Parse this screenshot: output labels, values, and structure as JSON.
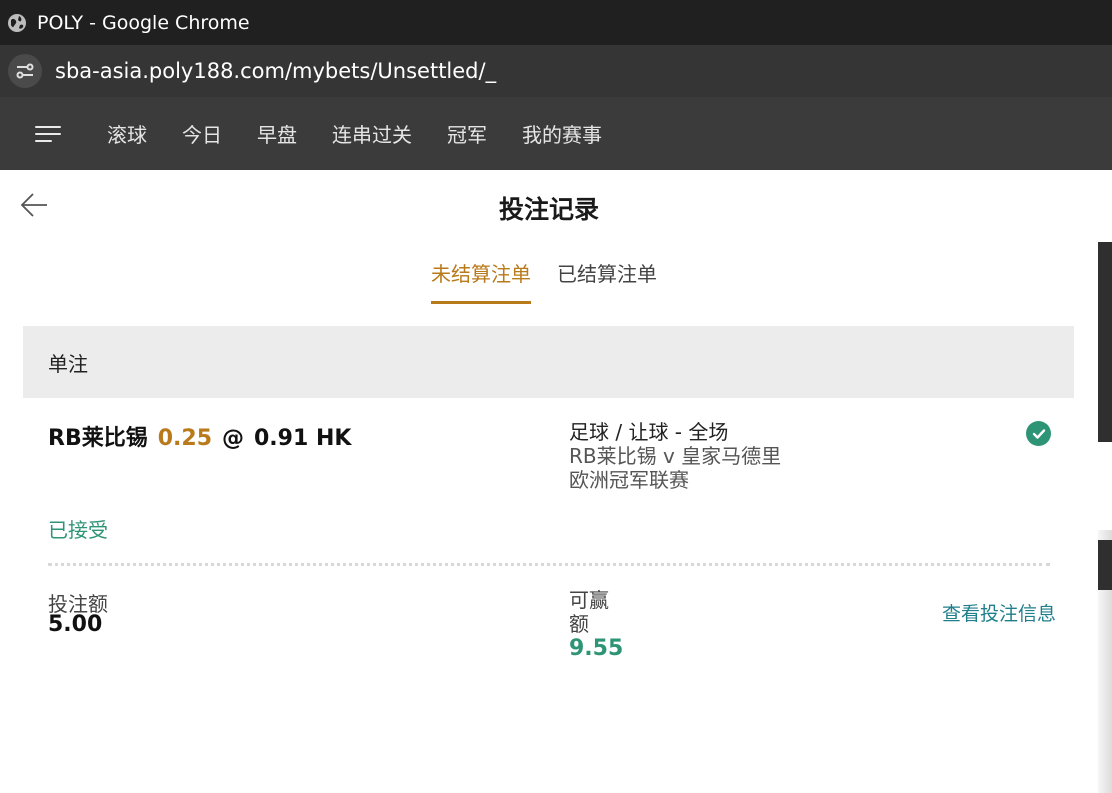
{
  "browser": {
    "window_title": "POLY - Google Chrome",
    "url": "sba-asia.poly188.com/mybets/Unsettled/_"
  },
  "nav": {
    "items": [
      "滚球",
      "今日",
      "早盘",
      "连串过关",
      "冠军",
      "我的赛事"
    ]
  },
  "page": {
    "title": "投注记录",
    "tabs": [
      {
        "label": "未结算注单",
        "active": true
      },
      {
        "label": "已结算注单",
        "active": false
      }
    ],
    "section_label": "单注"
  },
  "bet": {
    "selection": "RB莱比锡",
    "handicap": "0.25",
    "at": "@",
    "odds": "0.91 HK",
    "market": "足球 / 让球 - 全场",
    "match": "RB莱比锡 v 皇家马德里",
    "league": "欧洲冠军联赛",
    "status": "已接受",
    "stake_label": "投注额",
    "stake_value": "5.00",
    "win_label": "可赢额",
    "win_value": "9.55",
    "view_link": "查看投注信息"
  },
  "colors": {
    "accent_gold": "#b87a1a",
    "accent_green": "#2e9476",
    "link_teal": "#1f7f8a"
  },
  "icons": {
    "back": "arrow-left-icon",
    "menu": "hamburger-menu-icon",
    "status": "check-circle-icon",
    "site_info": "site-settings-icon",
    "favicon": "globe-icon"
  }
}
